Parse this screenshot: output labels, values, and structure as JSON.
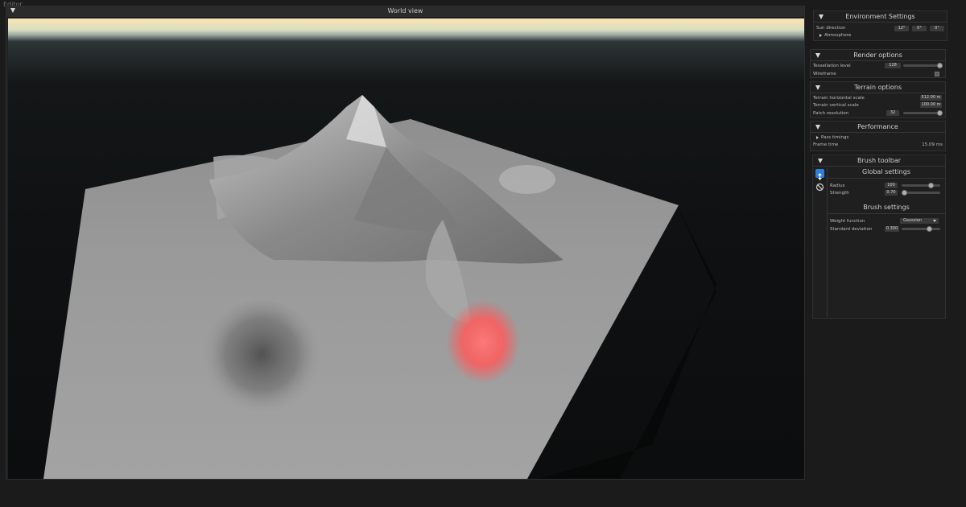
{
  "app": {
    "title": "Editor"
  },
  "world_view": {
    "title": "World view"
  },
  "environment": {
    "title": "Environment Settings",
    "sun_direction_label": "Sun direction",
    "sun_direction_values": [
      "12°",
      "0°",
      "0°"
    ],
    "atmosphere_label": "Atmosphere"
  },
  "render": {
    "title": "Render options",
    "tessellation_label": "Tessellation level",
    "tessellation_value": "128",
    "tessellation_fraction": 1.0,
    "wireframe_label": "Wireframe",
    "wireframe_checked": false
  },
  "terrain": {
    "title": "Terrain options",
    "hscale_label": "Terrain horizontal scale",
    "hscale_value": "512.00 m",
    "vscale_label": "Terrain vertical scale",
    "vscale_value": "100.00 m",
    "patch_label": "Patch resolution",
    "patch_value": "32",
    "patch_fraction": 1.0
  },
  "performance": {
    "title": "Performance",
    "pass_timings_label": "Pass timings",
    "frame_time_label": "Frame time",
    "frame_time_value": "15.09 ms"
  },
  "brush": {
    "title": "Brush toolbar",
    "global_title": "Global settings",
    "radius_label": "Radius",
    "radius_value": "100",
    "radius_fraction": 0.75,
    "strength_label": "Strength",
    "strength_value": "0.70",
    "strength_fraction": 0.08,
    "brush_settings_title": "Brush settings",
    "weight_label": "Weight function",
    "weight_value": "Gaussian",
    "stddev_label": "Standard deviation",
    "stddev_value": "0.300",
    "stddev_fraction": 0.72,
    "tools": [
      "raise-lower-tool-icon",
      "erase-tool-icon"
    ]
  },
  "colors": {
    "brush_highlight": "#ff6b6b",
    "selected_tool": "#2f7fd6"
  }
}
